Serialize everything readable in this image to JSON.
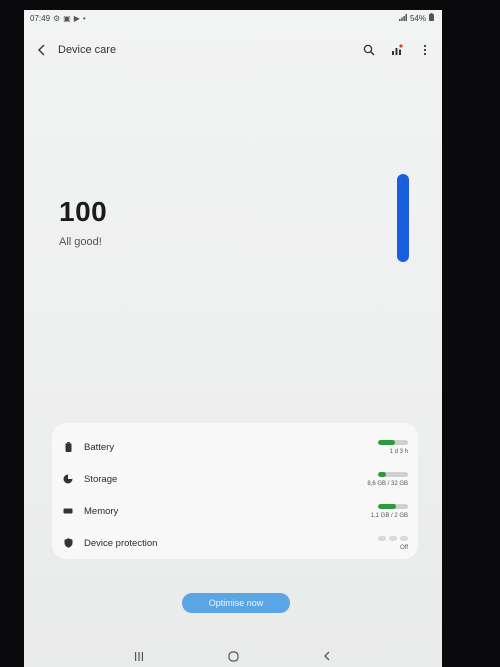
{
  "status_bar": {
    "time": "07:49",
    "battery": "54%"
  },
  "app_bar": {
    "title": "Device care",
    "icons": [
      "back-icon",
      "search-icon",
      "chart-icon",
      "more-icon"
    ]
  },
  "score": {
    "value": "100",
    "caption": "All good!"
  },
  "items": [
    {
      "label": "Battery",
      "value": "1 d 3 h",
      "level": 0.55,
      "icon": "battery-icon"
    },
    {
      "label": "Storage",
      "value": "8,6 GB / 32 GB",
      "level": 0.27,
      "icon": "storage-icon"
    },
    {
      "label": "Memory",
      "value": "1,1 GB / 2 GB",
      "level": 0.6,
      "icon": "memory-icon"
    },
    {
      "label": "Device protection",
      "value": "Off",
      "icon": "shield-icon"
    }
  ],
  "optimise_button": {
    "label": "Optimise now"
  },
  "colors": {
    "accent": "#1a5ee0",
    "button": "#5aa5e6",
    "bar_fill": "#2b9b3b"
  }
}
